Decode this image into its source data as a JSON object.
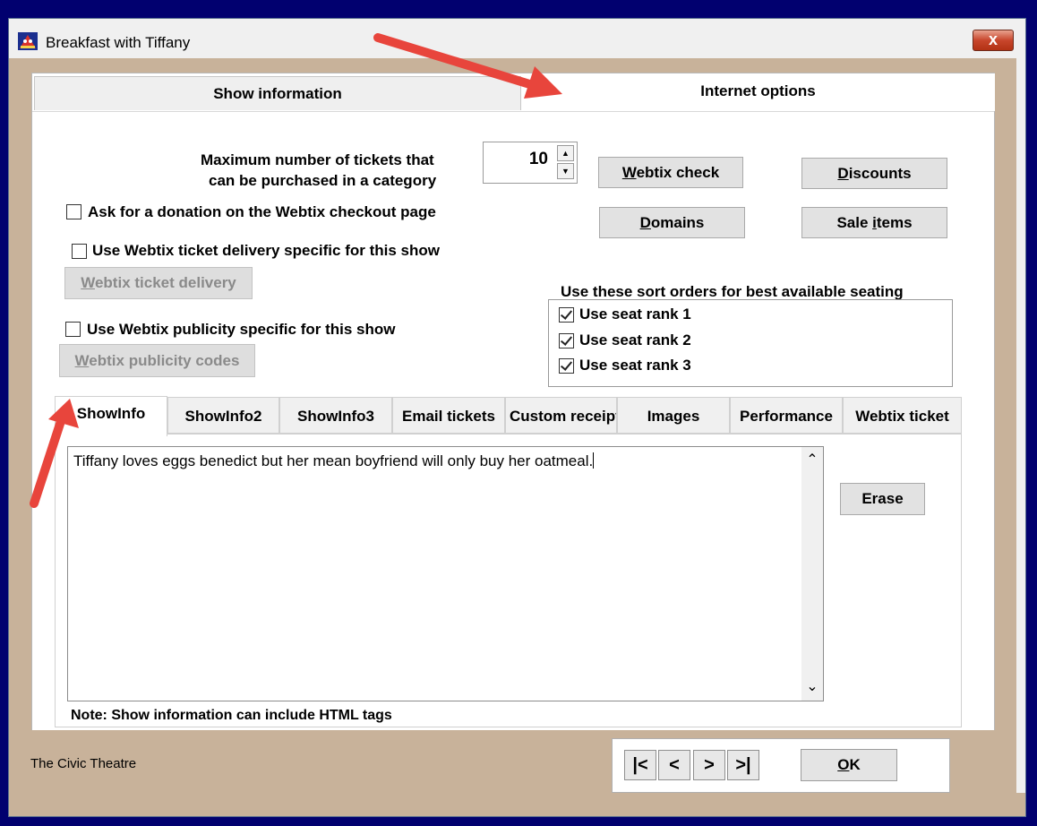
{
  "window": {
    "title": "Breakfast with Tiffany",
    "close_symbol": "x"
  },
  "top_tabs": [
    {
      "label": "Show information",
      "active": false
    },
    {
      "label": "Internet options",
      "active": true
    }
  ],
  "max_tickets": {
    "label_line1": "Maximum number of tickets that",
    "label_line2": "can be purchased in a category",
    "value": "10",
    "up_symbol": "▲",
    "down_symbol": "▼"
  },
  "buttons": {
    "webtix_check": {
      "underline": "W",
      "rest": "ebtix check"
    },
    "discounts": {
      "underline": "D",
      "rest": "iscounts"
    },
    "domains": {
      "underline": "D",
      "rest": "omains"
    },
    "sale_items_pre": "Sale ",
    "sale_items_underline": "i",
    "sale_items_post": "tems",
    "ticket_delivery": {
      "underline": "W",
      "rest": "ebtix ticket delivery"
    },
    "publicity_codes": {
      "underline": "W",
      "rest": "ebtix publicity codes"
    },
    "erase": "Erase",
    "ok": {
      "underline": "O",
      "rest": "K"
    }
  },
  "checkboxes": {
    "donation": {
      "label": "Ask for a donation on the Webtix checkout page",
      "checked": false
    },
    "delivery": {
      "label": "Use Webtix ticket delivery specific for this show",
      "checked": false
    },
    "publicity": {
      "label": "Use Webtix publicity specific for this show",
      "checked": false
    }
  },
  "sort_orders": {
    "title": "Use these sort orders for best available seating",
    "items": [
      {
        "label": "Use seat rank 1",
        "checked": true
      },
      {
        "label": "Use seat rank 2",
        "checked": true
      },
      {
        "label": "Use seat rank 3",
        "checked": true
      }
    ]
  },
  "sub_tabs": [
    {
      "label": "ShowInfo",
      "active": true
    },
    {
      "label": "ShowInfo2",
      "active": false
    },
    {
      "label": "ShowInfo3",
      "active": false
    },
    {
      "label": "Email tickets",
      "active": false
    },
    {
      "label": "Custom receipt",
      "active": false
    },
    {
      "label": "Images",
      "active": false
    },
    {
      "label": "Performance",
      "active": false
    },
    {
      "label": "Webtix ticket",
      "active": false
    }
  ],
  "show_info_text": "Tiffany loves eggs benedict but her mean boyfriend will only buy her oatmeal.",
  "note": "Note: Show information can include HTML tags",
  "scroll_up_symbol": "⌃",
  "scroll_down_symbol": "⌄",
  "nav": {
    "first": "|<",
    "prev": "<",
    "next": ">",
    "last": ">|"
  },
  "footer": {
    "venue": "The Civic Theatre"
  },
  "colors": {
    "annotation_arrow": "#e8453c",
    "desktop": "#01006f",
    "window_frame": "#c8b29a"
  }
}
